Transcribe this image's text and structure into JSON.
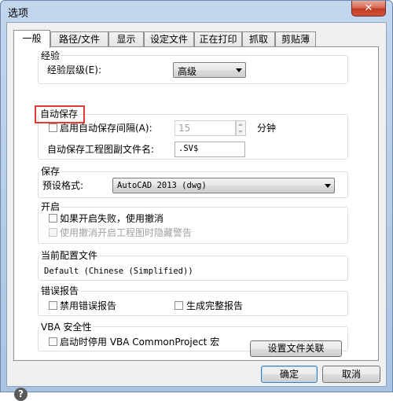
{
  "window": {
    "title": "选项",
    "close_glyph": "✕"
  },
  "tabs": [
    {
      "label": "一般",
      "active": true
    },
    {
      "label": "路径/文件"
    },
    {
      "label": "显示"
    },
    {
      "label": "设定文件"
    },
    {
      "label": "正在打印"
    },
    {
      "label": "抓取"
    },
    {
      "label": "剪贴薄"
    }
  ],
  "experience": {
    "group_label": "经验",
    "level_label": "经验层级(E):",
    "level_value": "高级"
  },
  "autosave": {
    "group_label": "自动保存",
    "interval_label": "启用自动保存间隔(A):",
    "interval_value": "15",
    "interval_unit": "分钟",
    "suffix_label": "自动保存工程图副文件名:",
    "suffix_value": ".SV$",
    "highlight_color": "#e53935"
  },
  "save": {
    "group_label": "保存",
    "format_label": "预设格式:",
    "format_value": "AutoCAD 2013 (dwg)"
  },
  "startup": {
    "group_label": "开启",
    "undo_label": "如果开启失败，使用撤消",
    "hide_warning_label": "使用撤消开启工程图时隐藏警告"
  },
  "profile": {
    "group_label": "当前配置文件",
    "value": "Default (Chinese (Simplified))"
  },
  "error_report": {
    "group_label": "错误报告",
    "disable_label": "禁用错误报告",
    "full_label": "生成完整报告"
  },
  "vba": {
    "group_label": "VBA 安全性",
    "disable_label": "启动时停用 VBA CommonProject 宏"
  },
  "buttons": {
    "file_assoc": "设置文件关联",
    "ok": "确定",
    "cancel": "取消",
    "help_glyph": "?"
  }
}
